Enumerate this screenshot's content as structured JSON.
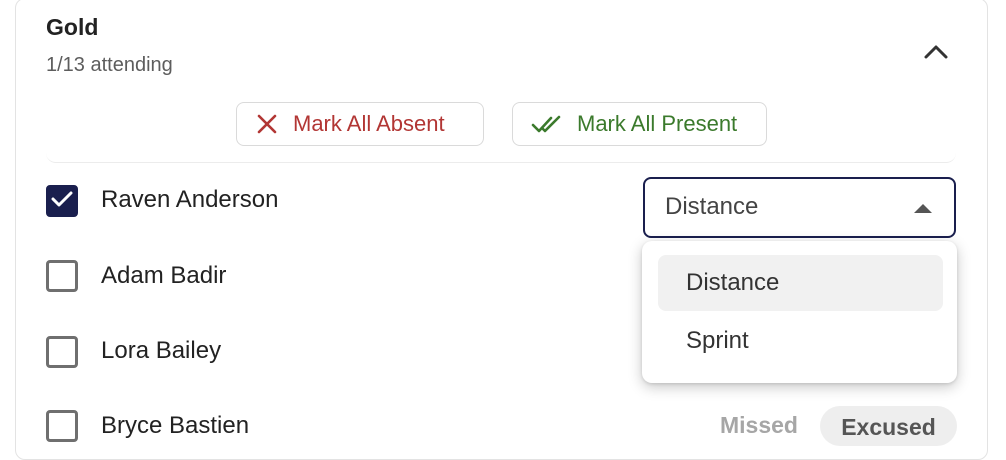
{
  "group": {
    "title": "Gold",
    "subtitle": "1/13 attending"
  },
  "actions": {
    "mark_absent": "Mark All Absent",
    "mark_present": "Mark All Present"
  },
  "athletes": [
    {
      "name": "Raven Anderson",
      "checked": true
    },
    {
      "name": "Adam Badir",
      "checked": false
    },
    {
      "name": "Lora Bailey",
      "checked": false
    },
    {
      "name": "Bryce Bastien",
      "checked": false
    }
  ],
  "event_select": {
    "value": "Distance",
    "options": [
      "Distance",
      "Sprint"
    ],
    "open": true
  },
  "status_options": {
    "missed": "Missed",
    "excused": "Excused"
  },
  "colors": {
    "primary": "#1a1f4e",
    "absent": "#b23634",
    "present": "#3b7a2c"
  },
  "icons": {
    "collapse": "chevron-up-icon",
    "absent": "close-icon",
    "present": "double-check-icon",
    "checkbox": "checkmark-icon",
    "select": "caret-up-icon"
  }
}
